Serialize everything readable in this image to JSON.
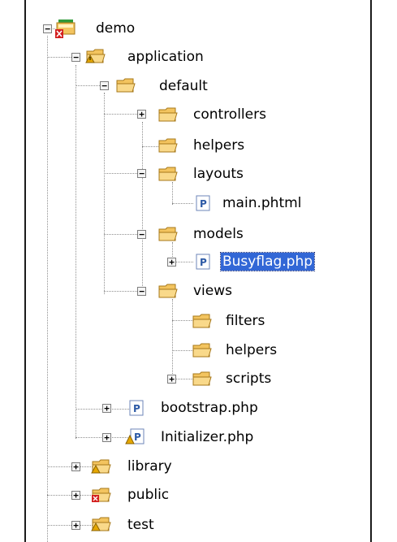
{
  "tree": {
    "demo": "demo",
    "application": "application",
    "default": "default",
    "controllers": "controllers",
    "helpers": "helpers",
    "layouts": "layouts",
    "main_phtml": "main.phtml",
    "models": "models",
    "busyflag_php": "Busyflag.php",
    "views": "views",
    "filters": "filters",
    "views_helpers": "helpers",
    "scripts": "scripts",
    "bootstrap_php": "bootstrap.php",
    "initializer_php": "Initializer.php",
    "library": "library",
    "public": "public",
    "test": "test"
  },
  "colors": {
    "selection": "#3267d6",
    "folder": "#f3c45f",
    "file_badge": "#2d5aa6",
    "warning": "#e5a700",
    "error": "#d32020"
  },
  "icons": {
    "project": "project-icon",
    "folder": "folder-icon",
    "source_folder": "source-folder-icon",
    "php_file": "php-file-icon"
  }
}
